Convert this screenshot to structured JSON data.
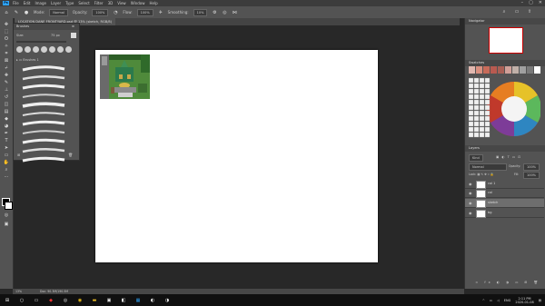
{
  "menubar": {
    "logo": "Ps",
    "items": [
      "File",
      "Edit",
      "Image",
      "Layer",
      "Type",
      "Select",
      "Filter",
      "3D",
      "View",
      "Window",
      "Help"
    ]
  },
  "options": {
    "mode_label": "Mode:",
    "mode_value": "Normal",
    "opacity_label": "Opacity:",
    "opacity_value": "100%",
    "flow_label": "Flow:",
    "flow_value": "100%",
    "smoothing_label": "Smoothing:",
    "smoothing_value": "10%"
  },
  "document": {
    "tab_title": "LOCATION DANE FRONTYARD.psd @ 13% (sketch, RGB/8)"
  },
  "brush_panel": {
    "title": "Brushes",
    "size_label": "Size:",
    "size_value": "75 px",
    "group_name": "Brushes 1"
  },
  "right_panel": {
    "navigator_title": "Navigator",
    "swatches_title": "Swatches",
    "swatch_colors": [
      "#e1b8b0",
      "#d99080",
      "#c86b5a",
      "#b85a50",
      "#a85f55",
      "#d1a098",
      "#c0b0a8",
      "#a0a0a0",
      "#7a7a7a",
      "#ffffff"
    ],
    "layers_title": "Layers",
    "kind_label": "Kind",
    "blend_value": "Normal",
    "opacity_label": "Opacity:",
    "opacity_value": "100%",
    "fill_label": "Fill:",
    "fill_value": "100%",
    "layers": [
      {
        "name": "col 1",
        "selected": false
      },
      {
        "name": "col",
        "selected": false
      },
      {
        "name": "sketch",
        "selected": true
      },
      {
        "name": "bg",
        "selected": false
      }
    ]
  },
  "status": {
    "zoom": "13%",
    "doc_info": "Doc: 90.3M/190.5M"
  },
  "taskbar": {
    "language": "ENG",
    "time": "2:11 PM",
    "date": "2020-01-08"
  },
  "colors": {
    "accent": "#2fa3f7",
    "panel_bg": "#535353",
    "workspace_bg": "#282828"
  }
}
